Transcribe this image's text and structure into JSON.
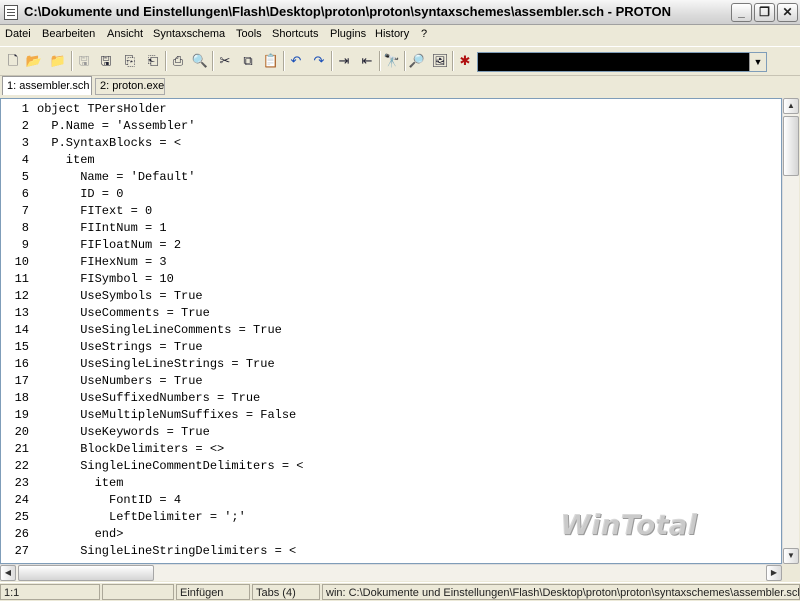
{
  "window": {
    "title": "C:\\Dokumente und Einstellungen\\Flash\\Desktop\\proton\\proton\\syntaxschemes\\assembler.sch - PROTON",
    "min_label": "_",
    "max_label": "❐",
    "close_label": "✕"
  },
  "menu": {
    "items": [
      "Datei",
      "Bearbeiten",
      "Ansicht",
      "Syntaxschema",
      "Tools",
      "Shortcuts",
      "Plugins",
      "History",
      "?"
    ]
  },
  "toolbar": {
    "icons": [
      "new-file-icon",
      "open-folder-icon",
      "open-recent-icon",
      "save-disabled-icon",
      "save-icon",
      "save-all-icon",
      "save-as-icon",
      "print-icon",
      "print-preview-icon",
      "cut-icon",
      "copy-icon",
      "paste-icon",
      "undo-icon",
      "redo-icon",
      "indent-icon",
      "outdent-icon",
      "find-icon",
      "find-in-files-icon",
      "image-icon",
      "plugin-icon"
    ],
    "combo_value": ""
  },
  "tabs": [
    {
      "label": "1: assembler.sch",
      "active": true
    },
    {
      "label": "2: proton.exe",
      "active": false
    }
  ],
  "editor": {
    "lines": [
      {
        "n": "1",
        "text": "object TPersHolder"
      },
      {
        "n": "2",
        "text": "  P.Name = 'Assembler'"
      },
      {
        "n": "3",
        "text": "  P.SyntaxBlocks = <"
      },
      {
        "n": "4",
        "text": "    item"
      },
      {
        "n": "5",
        "text": "      Name = 'Default'"
      },
      {
        "n": "6",
        "text": "      ID = 0"
      },
      {
        "n": "7",
        "text": "      FIText = 0"
      },
      {
        "n": "8",
        "text": "      FIIntNum = 1"
      },
      {
        "n": "9",
        "text": "      FIFloatNum = 2"
      },
      {
        "n": "10",
        "text": "      FIHexNum = 3"
      },
      {
        "n": "11",
        "text": "      FISymbol = 10"
      },
      {
        "n": "12",
        "text": "      UseSymbols = True"
      },
      {
        "n": "13",
        "text": "      UseComments = True"
      },
      {
        "n": "14",
        "text": "      UseSingleLineComments = True"
      },
      {
        "n": "15",
        "text": "      UseStrings = True"
      },
      {
        "n": "16",
        "text": "      UseSingleLineStrings = True"
      },
      {
        "n": "17",
        "text": "      UseNumbers = True"
      },
      {
        "n": "18",
        "text": "      UseSuffixedNumbers = True"
      },
      {
        "n": "19",
        "text": "      UseMultipleNumSuffixes = False"
      },
      {
        "n": "20",
        "text": "      UseKeywords = True"
      },
      {
        "n": "21",
        "text": "      BlockDelimiters = <>"
      },
      {
        "n": "22",
        "text": "      SingleLineCommentDelimiters = <"
      },
      {
        "n": "23",
        "text": "        item"
      },
      {
        "n": "24",
        "text": "          FontID = 4"
      },
      {
        "n": "25",
        "text": "          LeftDelimiter = ';'"
      },
      {
        "n": "26",
        "text": "        end>"
      },
      {
        "n": "27",
        "text": "      SingleLineStringDelimiters = <"
      }
    ]
  },
  "status": {
    "position": "1:1",
    "blank": "",
    "mode": "Einfügen",
    "tabs": "Tabs (4)",
    "path": "win: C:\\Dokumente und Einstellungen\\Flash\\Desktop\\proton\\proton\\syntaxschemes\\assembler.sch"
  },
  "watermark": "WinTotal"
}
